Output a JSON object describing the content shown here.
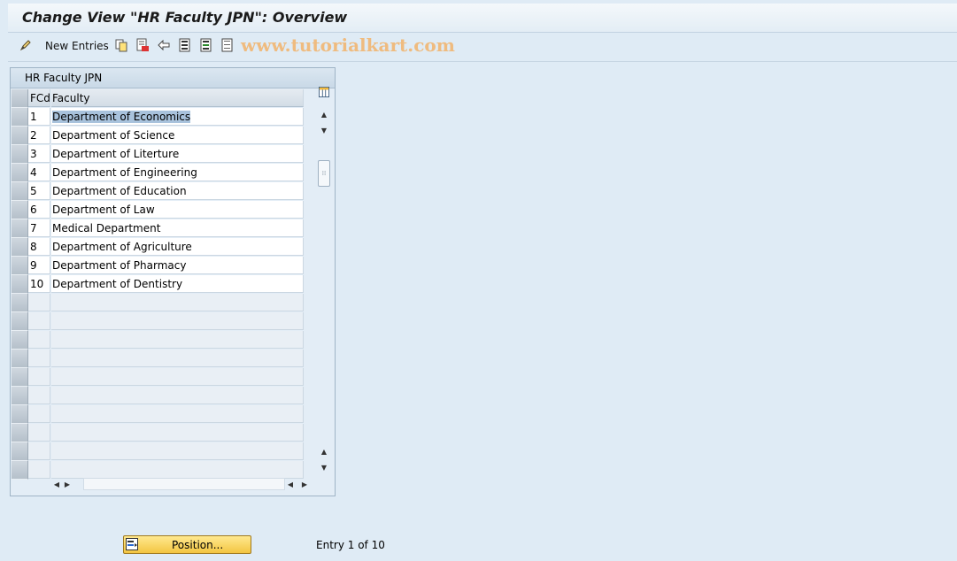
{
  "window": {
    "title": "Change View \"HR Faculty JPN\": Overview"
  },
  "toolbar": {
    "new_entries_label": "New Entries",
    "icons": [
      "edit-pencil-icon",
      "copy-icon",
      "delete-icon",
      "undo-icon",
      "select-all-icon",
      "select-block-icon",
      "deselect-all-icon"
    ],
    "watermark": "www.tutorialkart.com"
  },
  "table": {
    "title": "HR Faculty JPN",
    "columns": {
      "fcd": "FCd",
      "faculty": "Faculty"
    },
    "rows": [
      {
        "fcd": "1",
        "faculty": "Department of Economics"
      },
      {
        "fcd": "2",
        "faculty": "Department of Science"
      },
      {
        "fcd": "3",
        "faculty": "Department of Literture"
      },
      {
        "fcd": "4",
        "faculty": "Department of Engineering"
      },
      {
        "fcd": "5",
        "faculty": "Department of Education"
      },
      {
        "fcd": "6",
        "faculty": "Department of Law"
      },
      {
        "fcd": "7",
        "faculty": "Medical Department"
      },
      {
        "fcd": "8",
        "faculty": "Department of Agriculture"
      },
      {
        "fcd": "9",
        "faculty": "Department of Pharmacy"
      },
      {
        "fcd": "10",
        "faculty": "Department of Dentistry"
      }
    ],
    "selected_row": 1
  },
  "footer": {
    "position_label": "Position...",
    "entry_text": "Entry 1 of 10"
  },
  "colors": {
    "accent_button": "#f3c542",
    "selection": "#a8c2dc",
    "background": "#dfebf5"
  }
}
